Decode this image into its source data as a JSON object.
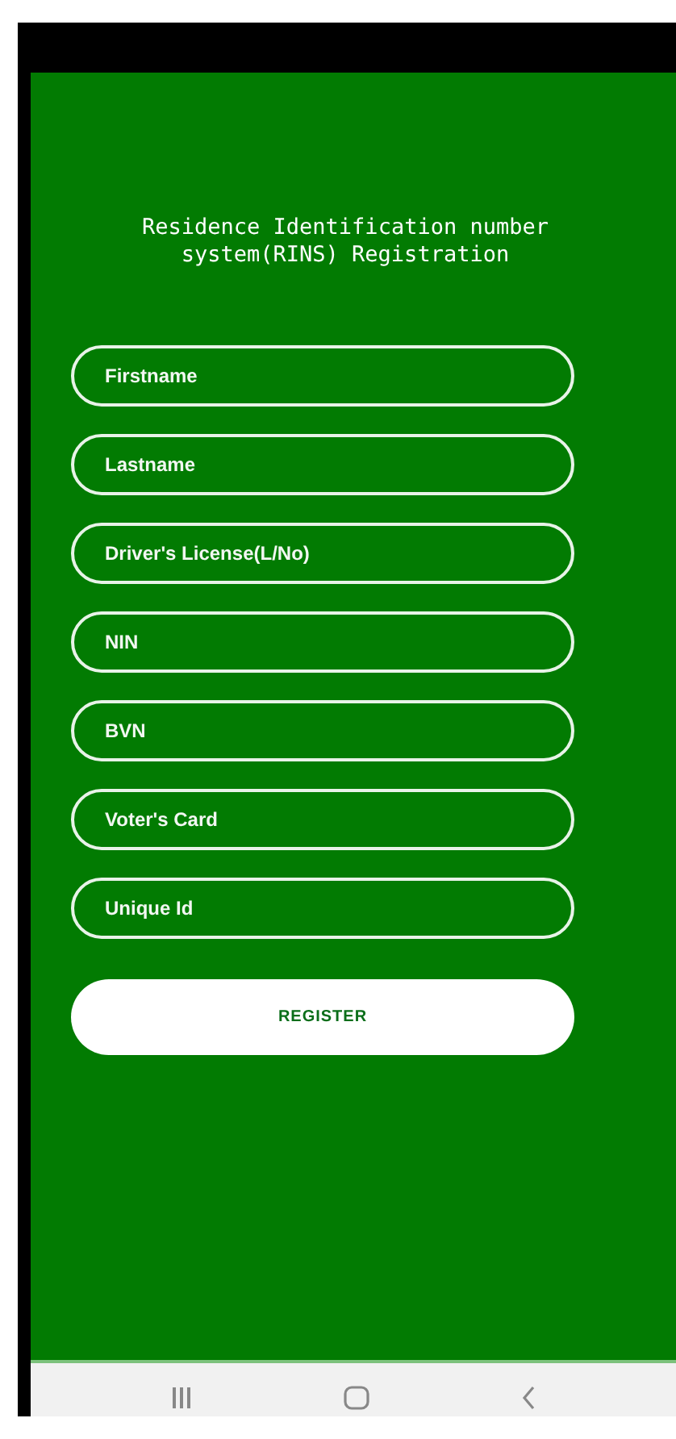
{
  "title": "Residence Identification number system(RINS) Registration",
  "fields": [
    {
      "placeholder": "Firstname"
    },
    {
      "placeholder": "Lastname"
    },
    {
      "placeholder": "Driver's License(L/No)"
    },
    {
      "placeholder": "NIN"
    },
    {
      "placeholder": "BVN"
    },
    {
      "placeholder": "Voter's Card"
    },
    {
      "placeholder": "Unique Id"
    }
  ],
  "button": "REGISTER"
}
